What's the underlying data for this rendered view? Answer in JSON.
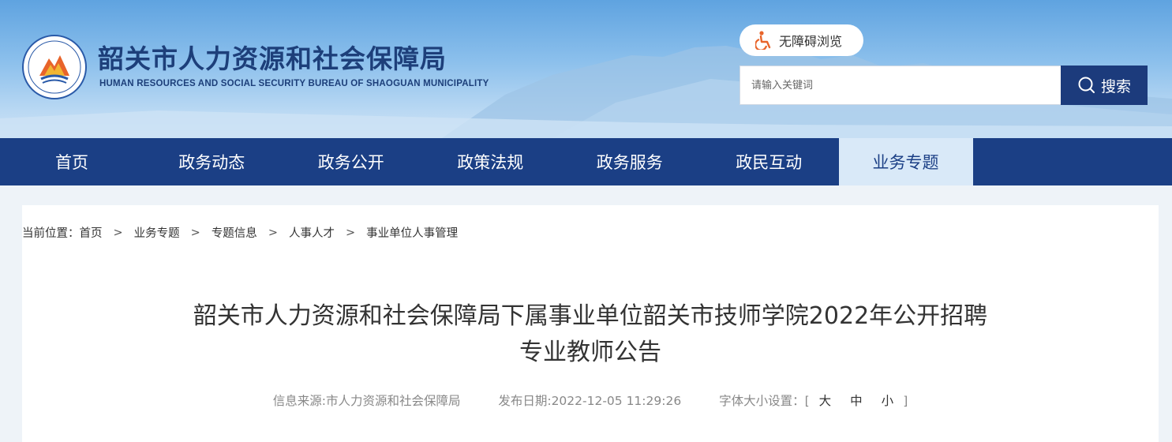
{
  "header": {
    "site_title": "韶关市人力资源和社会保障局",
    "site_subtitle": "HUMAN RESOURCES AND SOCIAL SECURITY BUREAU OF SHAOGUAN MUNICIPALITY",
    "accessibility_label": "无障碍浏览",
    "search_placeholder": "请输入关键词",
    "search_button_label": "搜索"
  },
  "nav": {
    "items": [
      {
        "label": "首页",
        "active": false
      },
      {
        "label": "政务动态",
        "active": false
      },
      {
        "label": "政务公开",
        "active": false
      },
      {
        "label": "政策法规",
        "active": false
      },
      {
        "label": "政务服务",
        "active": false
      },
      {
        "label": "政民互动",
        "active": false
      },
      {
        "label": "业务专题",
        "active": true
      }
    ]
  },
  "breadcrumb": {
    "prefix": "当前位置：",
    "items": [
      "首页",
      "业务专题",
      "专题信息",
      "人事人才",
      "事业单位人事管理"
    ],
    "separator": ">"
  },
  "article": {
    "title_line1": "韶关市人力资源和社会保障局下属事业单位韶关市技师学院2022年公开招聘",
    "title_line2": "专业教师公告",
    "source": "信息来源:市人力资源和社会保障局",
    "date": "发布日期:2022-12-05 11:29:26",
    "font_size_label": "字体大小设置：",
    "font_open": "[",
    "font_large": "大",
    "font_medium": "中",
    "font_small": "小",
    "font_close": "]"
  },
  "colors": {
    "nav_bg": "#1b3f85",
    "nav_active_bg": "#d9e9f8",
    "title_color": "#1d3f7a",
    "search_button_bg": "#1c3b7c",
    "accessibility_icon": "#e8642a"
  },
  "icons": {
    "logo": "bureau-emblem",
    "accessibility": "wheelchair-icon",
    "search": "search-icon"
  }
}
